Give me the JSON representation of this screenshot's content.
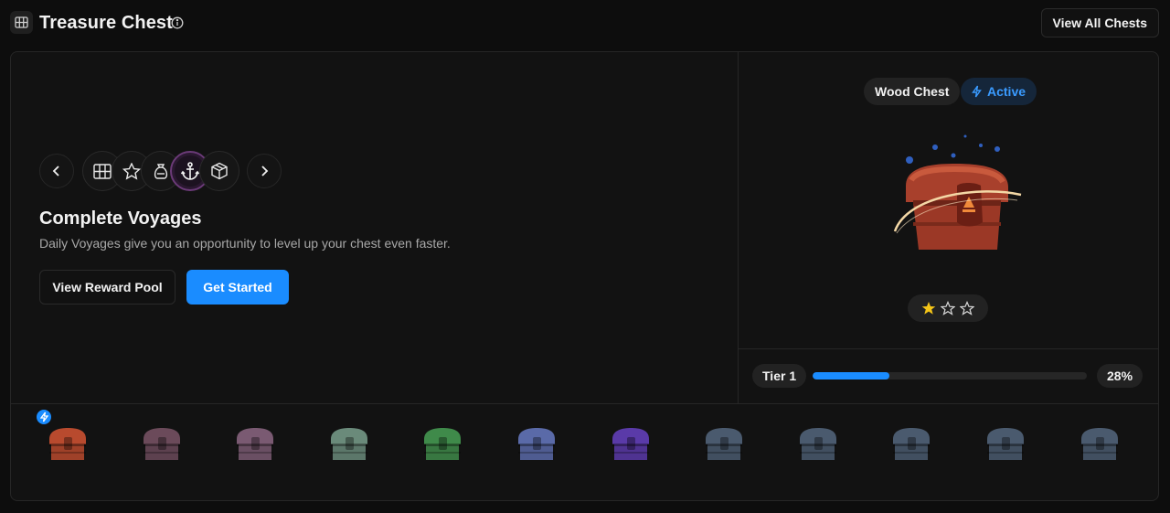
{
  "header": {
    "title": "Treasure Chest",
    "view_all_label": "View All Chests"
  },
  "left": {
    "heading": "Complete Voyages",
    "subtitle": "Daily Voyages give you an opportunity to level up your chest even faster.",
    "icons": [
      "map-icon",
      "star-icon",
      "money-bag-icon",
      "anchor-icon",
      "cube-icon"
    ],
    "active_icon_index": 3,
    "view_reward_pool_label": "View Reward Pool",
    "get_started_label": "Get Started"
  },
  "right": {
    "chest_name": "Wood Chest",
    "status_label": "Active",
    "stars_filled": 1,
    "stars_total": 3,
    "tier_label": "Tier 1",
    "progress_percent_label": "28%",
    "progress_value": 0.28
  },
  "strip": {
    "chest_colors": [
      "#b84a2e",
      "#6b4a5a",
      "#7a5a72",
      "#6a8a7a",
      "#3f8a4a",
      "#5a6aa8",
      "#5a3aa8",
      "#4a5a6e",
      "#4a5a6e",
      "#4a5a6e",
      "#4a5a6e",
      "#4a5a6e"
    ],
    "active_index": 0
  },
  "colors": {
    "accent": "#1a8cff",
    "star": "#f5c518"
  }
}
